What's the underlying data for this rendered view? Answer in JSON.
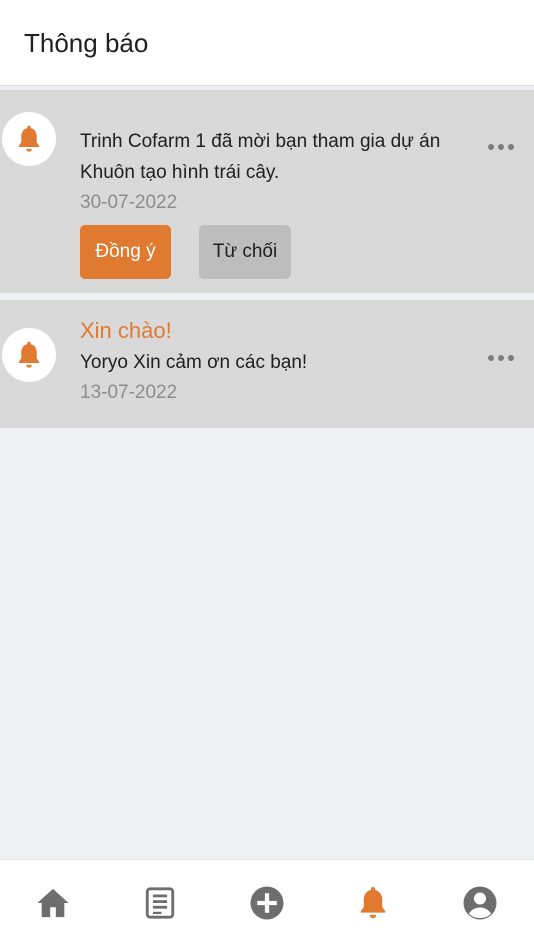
{
  "header": {
    "title": "Thông báo"
  },
  "notifications": [
    {
      "message": "Trinh Cofarm 1 đã mời bạn tham gia dự án Khuôn tạo hình trái cây.",
      "date": "30-07-2022",
      "accept_label": "Đồng ý",
      "reject_label": "Từ chối"
    },
    {
      "heading": "Xin chào!",
      "message": "Yoryo Xin cảm ơn các bạn!",
      "date": "13-07-2022"
    }
  ],
  "icons": {
    "notification": "bell-icon",
    "more": "more-horizontal-icon",
    "tabs": [
      "home-icon",
      "document-icon",
      "add-circle-icon",
      "bell-icon",
      "user-circle-icon"
    ]
  },
  "colors": {
    "accent": "#e07a30",
    "card_bg": "#d9d9d9",
    "page_bg": "#eef0f4",
    "tab_inactive": "#6e6e6e"
  },
  "bottom_nav": {
    "active_index": 3
  }
}
